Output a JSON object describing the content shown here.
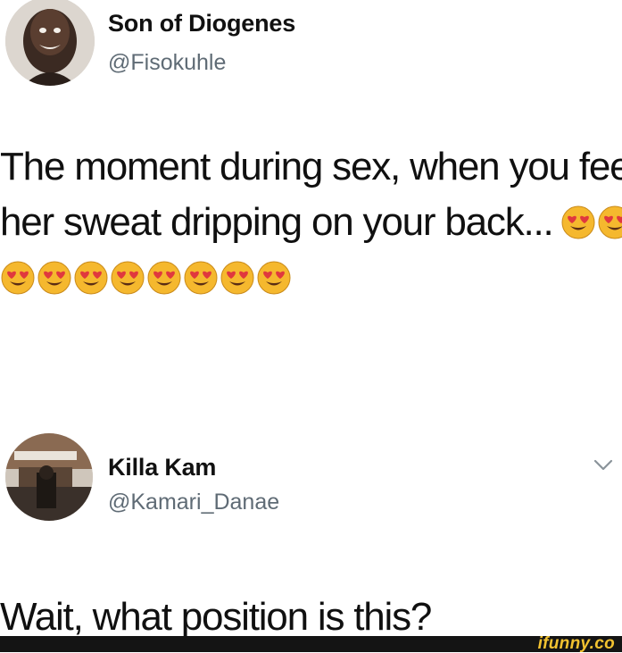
{
  "tweets": [
    {
      "author": {
        "display_name": "Son of Diogenes",
        "handle": "@Fisokuhle",
        "avatar_icon": "profile-photo-man-smiling"
      },
      "text_lines": [
        "The moment during sex, when you feel",
        "her sweat dripping on your back..."
      ],
      "emoji": "smiling-face-with-heart-eyes",
      "emoji_count_line2": 2,
      "emoji_count_line3": 8
    },
    {
      "author": {
        "display_name": "Killa Kam",
        "handle": "@Kamari_Danae",
        "avatar_icon": "profile-photo-room-scene"
      },
      "text_lines": [
        "Wait, what position is this?"
      ],
      "menu_icon": "chevron-down-icon"
    }
  ],
  "watermark": "ifunny.co",
  "colors": {
    "background": "#ffffff",
    "text": "#101010",
    "handle": "#5f6b75",
    "footer_bar": "#141414",
    "watermark": "#f2c230",
    "emoji_face": "#f5b82e",
    "emoji_heart": "#e0383e"
  }
}
